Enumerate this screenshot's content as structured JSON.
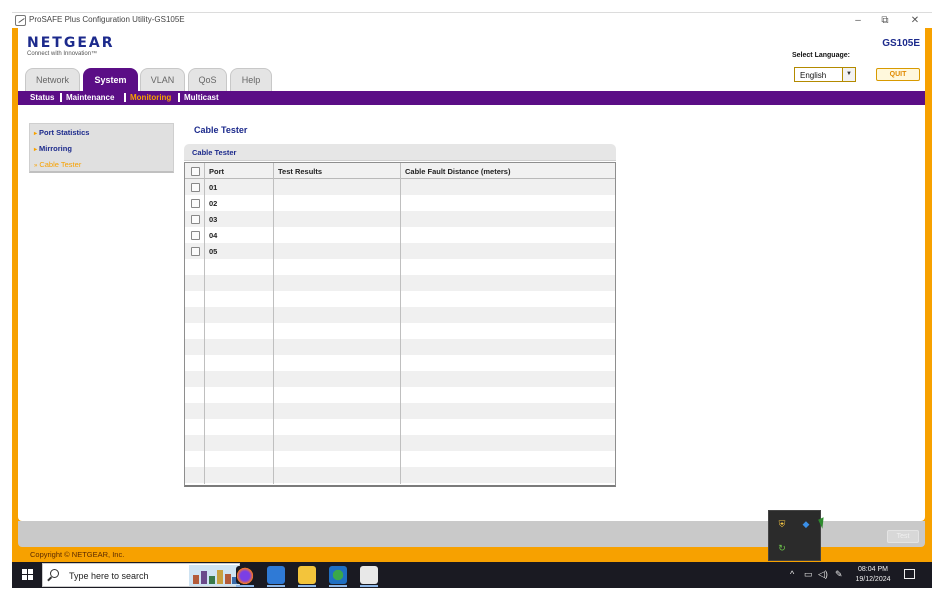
{
  "window": {
    "title": "ProSAFE Plus Configuration Utility-GS105E",
    "minimize": "–",
    "restore": "⧉",
    "close": "✕"
  },
  "header": {
    "logo": "NETGEAR",
    "tagline": "Connect with Innovation™",
    "model": "GS105E",
    "language_label": "Select Language:",
    "language_value": "English",
    "quit_label": "QUIT"
  },
  "tabs": [
    {
      "label": "Network",
      "active": false
    },
    {
      "label": "System",
      "active": true
    },
    {
      "label": "VLAN",
      "active": false
    },
    {
      "label": "QoS",
      "active": false
    },
    {
      "label": "Help",
      "active": false
    }
  ],
  "subnav": [
    {
      "label": "Status",
      "active": false
    },
    {
      "label": "Maintenance",
      "active": false
    },
    {
      "label": "Monitoring",
      "active": true
    },
    {
      "label": "Multicast",
      "active": false
    }
  ],
  "sidenav": [
    {
      "label": "Port Statistics",
      "active": false
    },
    {
      "label": "Mirroring",
      "active": false
    },
    {
      "label": "Cable Tester",
      "active": true
    }
  ],
  "page_title": "Cable Tester",
  "panel": {
    "title": "Cable Tester",
    "columns": [
      "Port",
      "Test Results",
      "Cable Fault Distance (meters)"
    ],
    "rows": [
      {
        "port": "01",
        "result": "",
        "distance": ""
      },
      {
        "port": "02",
        "result": "",
        "distance": ""
      },
      {
        "port": "03",
        "result": "",
        "distance": ""
      },
      {
        "port": "04",
        "result": "",
        "distance": ""
      },
      {
        "port": "05",
        "result": "",
        "distance": ""
      }
    ]
  },
  "footer": {
    "test_label": "Test",
    "copyright": "Copyright © NETGEAR, Inc."
  },
  "taskbar": {
    "search_placeholder": "Type here to search",
    "time": "08:04 PM",
    "date": "19/12/2024",
    "apps": [
      "firefox-icon",
      "paint-icon",
      "file-explorer-icon",
      "network-app-icon",
      "prosafe-icon"
    ]
  },
  "colors": {
    "brand_orange": "#f7a100",
    "brand_purple": "#5b0e86",
    "brand_blue": "#1c2a8c"
  }
}
